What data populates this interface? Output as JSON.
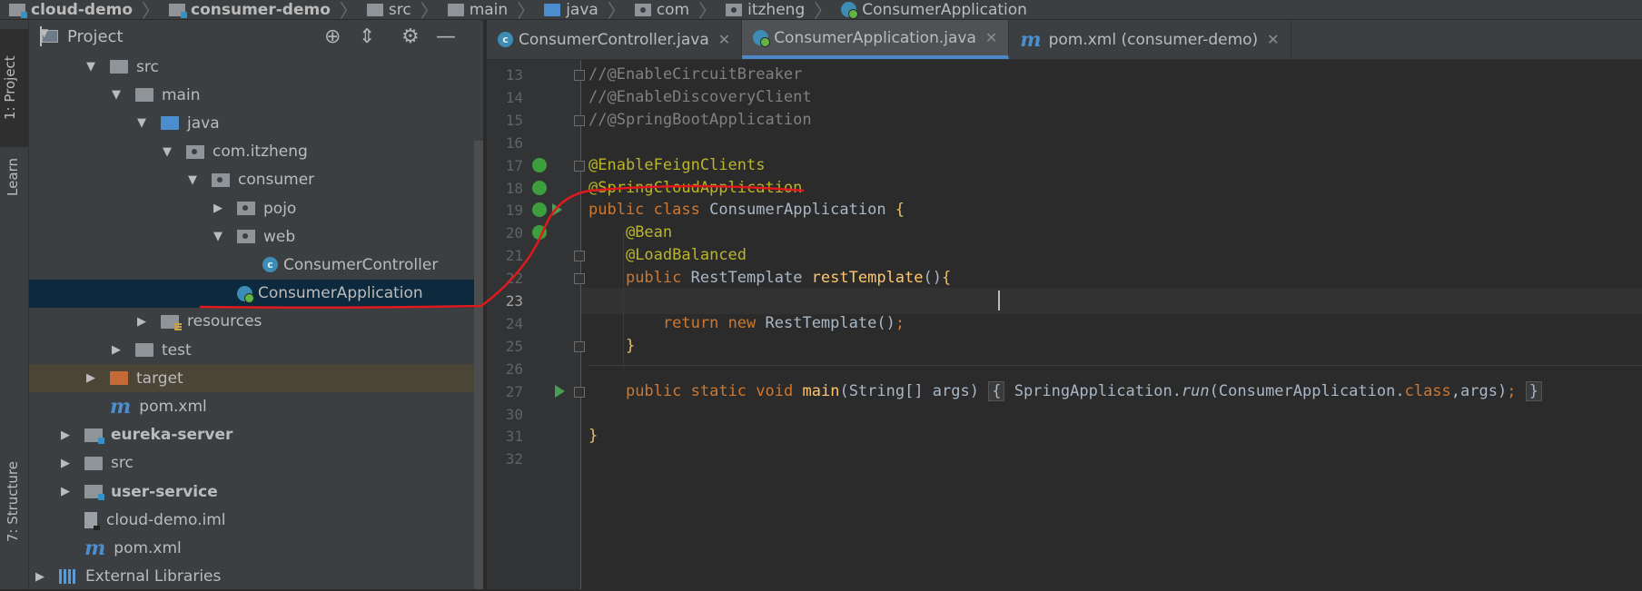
{
  "breadcrumb": [
    {
      "label": "cloud-demo",
      "icon": "module-icon",
      "bold": true
    },
    {
      "label": "consumer-demo",
      "icon": "module-icon",
      "bold": true
    },
    {
      "label": "src",
      "icon": "folder-icon"
    },
    {
      "label": "main",
      "icon": "folder-icon"
    },
    {
      "label": "java",
      "icon": "source-folder-icon"
    },
    {
      "label": "com",
      "icon": "package-icon"
    },
    {
      "label": "itzheng",
      "icon": "package-icon"
    },
    {
      "label": "ConsumerApplication",
      "icon": "spring-app-icon"
    }
  ],
  "tool_strip": {
    "project": "1: Project",
    "learn": "Learn",
    "structure": "7: Structure"
  },
  "project_panel": {
    "title": "Project",
    "tree": [
      {
        "label": "src",
        "depth": 2,
        "arrow": "down",
        "icon": "folder"
      },
      {
        "label": "main",
        "depth": 3,
        "arrow": "down",
        "icon": "folder"
      },
      {
        "label": "java",
        "depth": 4,
        "arrow": "down",
        "icon": "source-folder"
      },
      {
        "label": "com.itzheng",
        "depth": 5,
        "arrow": "down",
        "icon": "package"
      },
      {
        "label": "consumer",
        "depth": 6,
        "arrow": "down",
        "icon": "package"
      },
      {
        "label": "pojo",
        "depth": 7,
        "arrow": "right",
        "icon": "package"
      },
      {
        "label": "web",
        "depth": 7,
        "arrow": "down",
        "icon": "package"
      },
      {
        "label": "ConsumerController",
        "depth": 8,
        "arrow": "none",
        "icon": "class"
      },
      {
        "label": "ConsumerApplication",
        "depth": 7,
        "arrow": "none",
        "icon": "spring-app",
        "selected": true
      },
      {
        "label": "resources",
        "depth": 4,
        "arrow": "right",
        "icon": "resources"
      },
      {
        "label": "test",
        "depth": 3,
        "arrow": "right",
        "icon": "folder"
      },
      {
        "label": "target",
        "depth": 2,
        "arrow": "right",
        "icon": "excluded",
        "excluded": true
      },
      {
        "label": "pom.xml",
        "depth": 2,
        "arrow": "none",
        "icon": "maven"
      },
      {
        "label": "eureka-server",
        "depth": 1,
        "arrow": "right",
        "icon": "module",
        "bold": true
      },
      {
        "label": "src",
        "depth": 1,
        "arrow": "right",
        "icon": "folder"
      },
      {
        "label": "user-service",
        "depth": 1,
        "arrow": "right",
        "icon": "module",
        "bold": true
      },
      {
        "label": "cloud-demo.iml",
        "depth": 1,
        "arrow": "none",
        "icon": "iml"
      },
      {
        "label": "pom.xml",
        "depth": 1,
        "arrow": "none",
        "icon": "maven"
      },
      {
        "label": "External Libraries",
        "depth": 0,
        "arrow": "right",
        "icon": "libraries"
      }
    ]
  },
  "tabs": [
    {
      "label": "ConsumerController.java",
      "icon": "class-icon",
      "active": false
    },
    {
      "label": "ConsumerApplication.java",
      "icon": "spring-app-icon",
      "active": true
    },
    {
      "label": "pom.xml (consumer-demo)",
      "icon": "maven-icon",
      "active": false
    }
  ],
  "editor": {
    "current_line": "23",
    "lines": [
      {
        "n": "13",
        "text": "//@EnableCircuitBreaker"
      },
      {
        "n": "14",
        "text": "//@EnableDiscoveryClient"
      },
      {
        "n": "15",
        "text": "//@SpringBootApplication"
      },
      {
        "n": "16",
        "text": ""
      },
      {
        "n": "17",
        "text": "@EnableFeignClients"
      },
      {
        "n": "18",
        "text": "@SpringCloudApplication"
      },
      {
        "n": "19",
        "text": "public class ConsumerApplication {"
      },
      {
        "n": "20",
        "text": "    @Bean"
      },
      {
        "n": "21",
        "text": "    @LoadBalanced"
      },
      {
        "n": "22",
        "text": "    public RestTemplate restTemplate(){"
      },
      {
        "n": "23",
        "text": ""
      },
      {
        "n": "24",
        "text": "        return new RestTemplate();"
      },
      {
        "n": "25",
        "text": "    }"
      },
      {
        "n": "26",
        "text": ""
      },
      {
        "n": "27",
        "text": "    public static void main(String[] args) { SpringApplication.run(ConsumerApplication.class,args); }"
      },
      {
        "n": "30",
        "text": ""
      },
      {
        "n": "31",
        "text": "}"
      },
      {
        "n": "32",
        "text": ""
      }
    ]
  },
  "colors": {
    "annotation": "#bbb529",
    "keyword": "#cc7832",
    "comment": "#808080",
    "method": "#ffc66d",
    "text": "#a9b7c6",
    "selection": "#0d293e",
    "red_marker": "#e0191e"
  }
}
